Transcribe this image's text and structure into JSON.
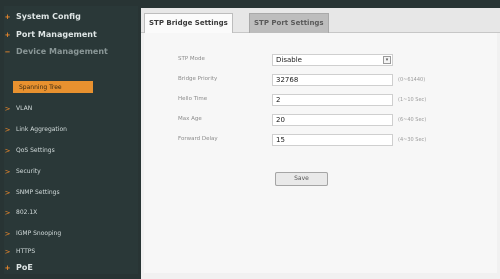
{
  "sidebar": {
    "items": [
      {
        "label": "System Config",
        "marker": "+"
      },
      {
        "label": "Port Management",
        "marker": "+"
      },
      {
        "label": "Device Management",
        "marker": "−"
      },
      {
        "label": "Spanning Tree"
      },
      {
        "label": "VLAN",
        "marker": ">"
      },
      {
        "label": "Link Aggregation",
        "marker": ">"
      },
      {
        "label": "QoS Settings",
        "marker": ">"
      },
      {
        "label": "Security",
        "marker": ">"
      },
      {
        "label": "SNMP Settings",
        "marker": ">"
      },
      {
        "label": "802.1X",
        "marker": ">"
      },
      {
        "label": "IGMP Snooping",
        "marker": ">"
      },
      {
        "label": "HTTPS",
        "marker": ">"
      },
      {
        "label": "PoE",
        "marker": "+"
      }
    ]
  },
  "tabs": [
    {
      "label": "STP Bridge Settings"
    },
    {
      "label": "STP Port Settings"
    }
  ],
  "form": {
    "stp_mode": {
      "label": "STP Mode",
      "value": "Disable"
    },
    "bridge_priority": {
      "label": "Bridge Priority",
      "value": "32768",
      "hint": "(0~61440)"
    },
    "hello_time": {
      "label": "Hello Time",
      "value": "2",
      "hint": "(1~10 Sec)"
    },
    "max_age": {
      "label": "Max Age",
      "value": "20",
      "hint": "(6~40 Sec)"
    },
    "forward_delay": {
      "label": "Forward Delay",
      "value": "15",
      "hint": "(4~30 Sec)"
    }
  },
  "buttons": {
    "save": "Save"
  },
  "colors": {
    "accent": "#e8912f",
    "sidebar_bg": "#2a3838",
    "panel_bg": "#f7f7f7"
  }
}
